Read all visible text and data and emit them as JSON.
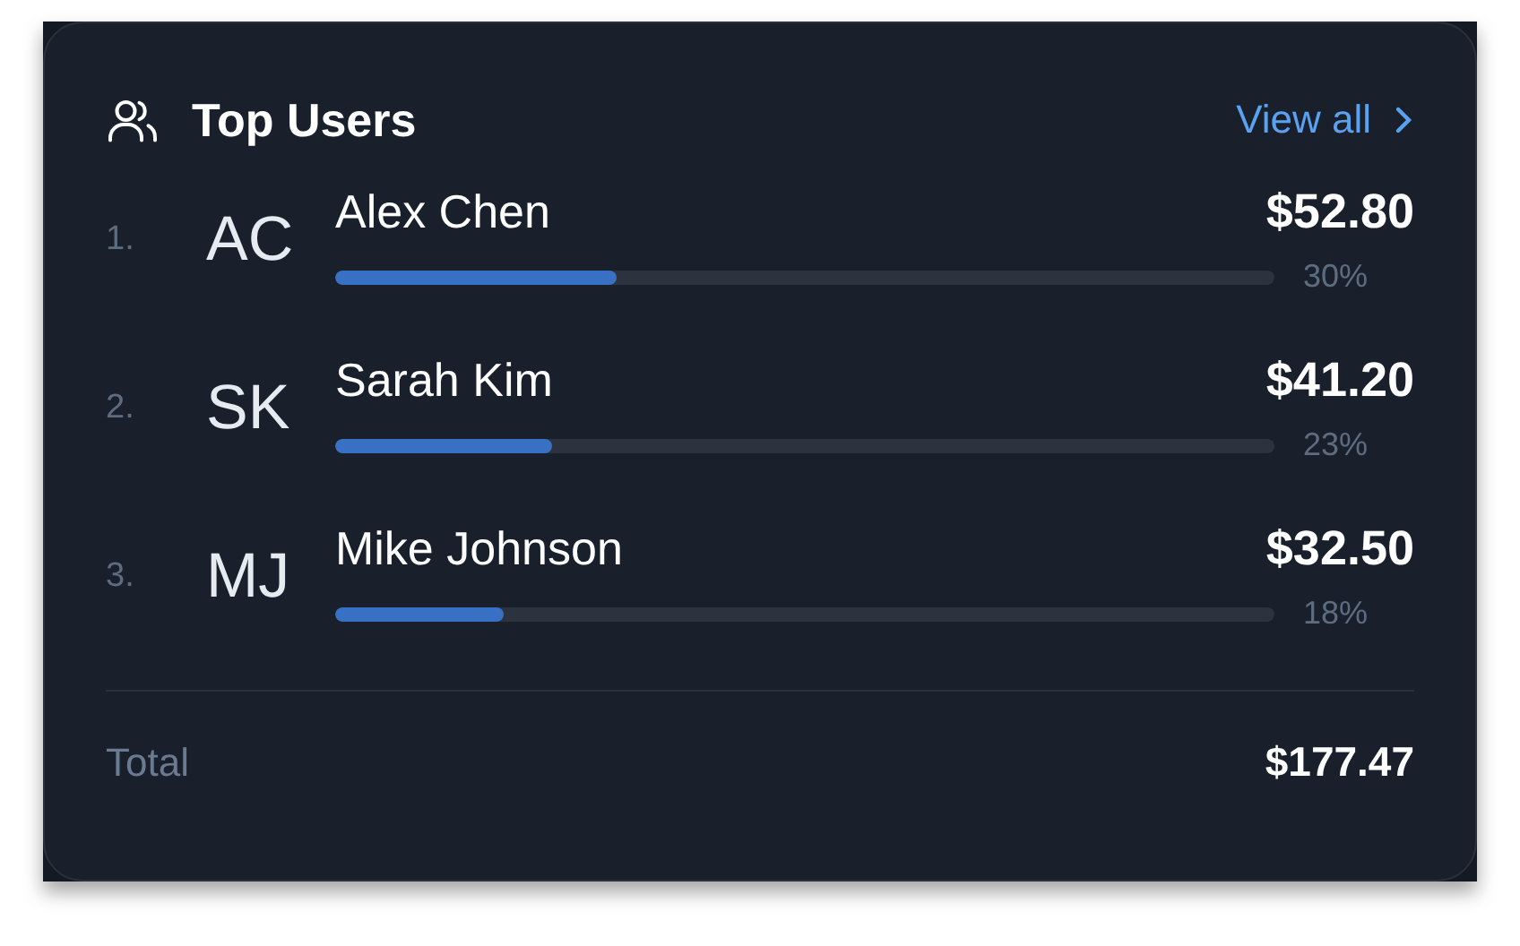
{
  "header": {
    "title": "Top Users",
    "link": "View all"
  },
  "users": [
    {
      "rank": "1.",
      "initials": "AC",
      "name": "Alex Chen",
      "amount": "$52.80",
      "level": 0.3,
      "percent": "30%"
    },
    {
      "rank": "2.",
      "initials": "SK",
      "name": "Sarah Kim",
      "amount": "$41.20",
      "level": 0.23,
      "percent": "23%"
    },
    {
      "rank": "3.",
      "initials": "MJ",
      "name": "Mike Johnson",
      "amount": "$32.50",
      "level": 0.18,
      "percent": "18%"
    }
  ],
  "total": {
    "label": "Total",
    "value": "$177.47"
  }
}
